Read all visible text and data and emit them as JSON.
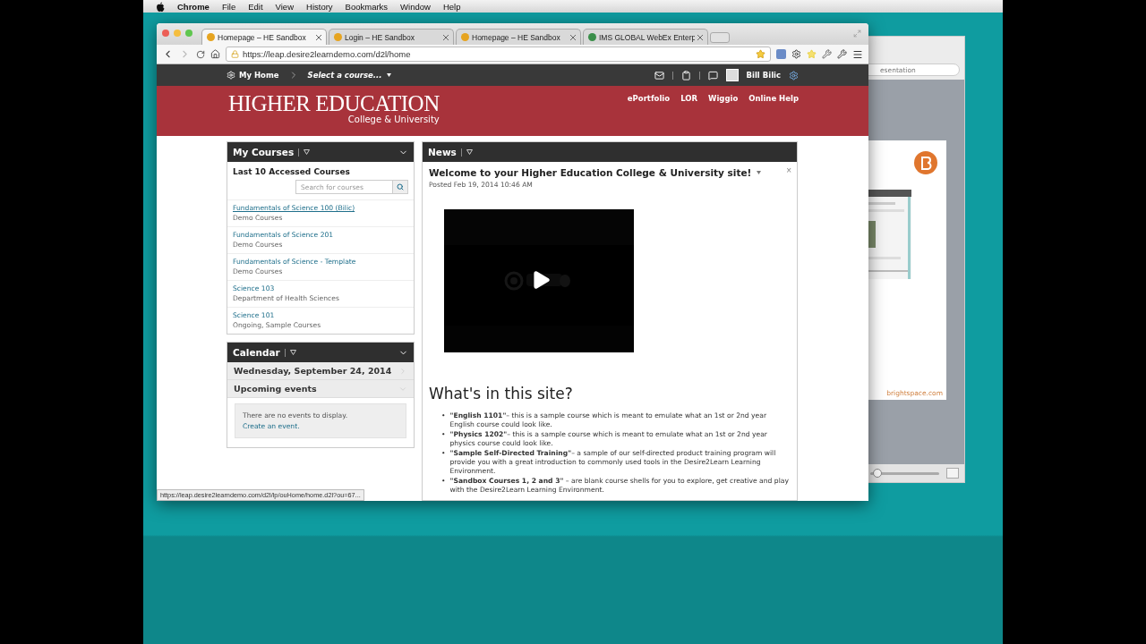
{
  "menubar": {
    "app": "Chrome",
    "items": [
      "File",
      "Edit",
      "View",
      "History",
      "Bookmarks",
      "Window",
      "Help"
    ]
  },
  "browser": {
    "tabs": [
      {
        "title": "Homepage – HE Sandbox",
        "selected": true
      },
      {
        "title": "Login – HE Sandbox",
        "selected": false
      },
      {
        "title": "Homepage – HE Sandbox",
        "selected": false
      },
      {
        "title": "IMS GLOBAL WebEx Enterp",
        "selected": false
      }
    ],
    "url": "https://leap.desire2learndemo.com/d2l/home",
    "status_url": "https://leap.desire2learndemo.com/d2l/lp/ouHome/home.d2l?ou=67..."
  },
  "navbar": {
    "home": "My Home",
    "course_selector": "Select a course...",
    "user": "Bill Bilic"
  },
  "banner": {
    "title": "HIGHER EDUCATION",
    "subtitle": "College & University",
    "links": [
      "ePortfolio",
      "LOR",
      "Wiggio",
      "Online Help"
    ]
  },
  "my_courses": {
    "title": "My Courses",
    "heading": "Last 10 Accessed Courses",
    "search": {
      "placeholder": "Search for courses"
    },
    "courses": [
      {
        "name": "Fundamentals of Science 100 (Bilic)",
        "group": "Demo Courses",
        "hovered": true
      },
      {
        "name": "Fundamentals of Science 201",
        "group": "Demo Courses",
        "hovered": false
      },
      {
        "name": "Fundamentals of Science - Template",
        "group": "Demo Courses",
        "hovered": false
      },
      {
        "name": "Science 103",
        "group": "Department of Health Sciences",
        "hovered": false
      },
      {
        "name": "Science 101",
        "group": "Ongoing, Sample Courses",
        "hovered": false
      }
    ]
  },
  "calendar": {
    "title": "Calendar",
    "date": "Wednesday, September 24, 2014",
    "upcoming": "Upcoming events",
    "empty": "There are no events to display.",
    "create": "Create an event."
  },
  "news": {
    "title": "News",
    "bullet": "•",
    "item_title": "Welcome to your Higher Education College & University site!",
    "posted": "Posted Feb 19, 2014 10:46 AM",
    "close": "×",
    "video": {
      "kind": "picture"
    },
    "heading": "What's in this site?",
    "bullets": [
      "**\"English 1101\"**– this is a sample course which is meant to emulate what an 1st or 2nd year English course could look like.",
      "**\"Physics 1202\"**– this is a sample course which is meant to emulate what an 1st or 2nd year physics course could look like.",
      "**\"Sample Self-Directed Training\"**– a sample of our self-directed product training program will provide you with a great introduction to commonly used tools in the Desire2Learn Learning Environment.",
      "**\"Sandbox Courses 1, 2 and 3\"** – are blank course shells for you to explore, get creative and play with the Desire2Learn Learning Environment."
    ]
  },
  "back_window": {
    "search_value": "esentation",
    "slide_footer": "brightspace.com",
    "zoom": {
      "level": 0.1
    }
  }
}
